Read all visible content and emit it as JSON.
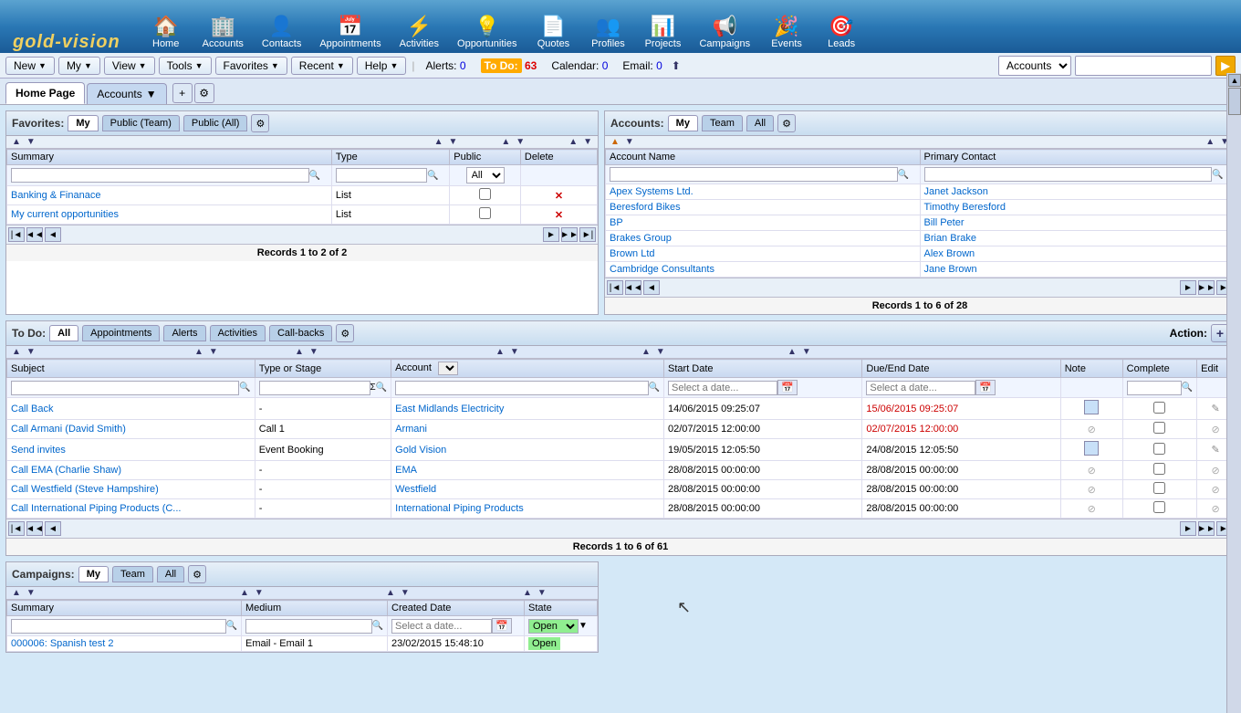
{
  "logo": {
    "text": "gold-vision"
  },
  "topnav": {
    "items": [
      {
        "id": "home",
        "label": "Home",
        "icon": "🏠"
      },
      {
        "id": "accounts",
        "label": "Accounts",
        "icon": "🏢"
      },
      {
        "id": "contacts",
        "label": "Contacts",
        "icon": "👤"
      },
      {
        "id": "appointments",
        "label": "Appointments",
        "icon": "📅"
      },
      {
        "id": "activities",
        "label": "Activities",
        "icon": "⚡"
      },
      {
        "id": "opportunities",
        "label": "Opportunities",
        "icon": "💡"
      },
      {
        "id": "quotes",
        "label": "Quotes",
        "icon": "📄"
      },
      {
        "id": "profiles",
        "label": "Profiles",
        "icon": "👥"
      },
      {
        "id": "projects",
        "label": "Projects",
        "icon": "📊"
      },
      {
        "id": "campaigns",
        "label": "Campaigns",
        "icon": "📢"
      },
      {
        "id": "events",
        "label": "Events",
        "icon": "🎉"
      },
      {
        "id": "leads",
        "label": "Leads",
        "icon": "🎯"
      }
    ]
  },
  "toolbar": {
    "new_label": "New",
    "my_label": "My",
    "view_label": "View",
    "tools_label": "Tools",
    "favorites_label": "Favorites",
    "recent_label": "Recent",
    "help_label": "Help",
    "alerts_label": "Alerts:",
    "alerts_count": "0",
    "todo_label": "To Do:",
    "todo_count": "63",
    "calendar_label": "Calendar:",
    "calendar_count": "0",
    "email_label": "Email:",
    "email_count": "0",
    "search_placeholder": "",
    "search_select_value": "Accounts"
  },
  "tabs": {
    "home_label": "Home Page",
    "accounts_label": "Accounts"
  },
  "favorites_panel": {
    "title": "Favorites:",
    "tabs": [
      "My",
      "Public (Team)",
      "Public (All)"
    ],
    "active_tab": "My",
    "columns": {
      "summary": "Summary",
      "type": "Type",
      "public": "Public",
      "delete": "Delete"
    },
    "rows": [
      {
        "summary": "Banking & Finanace",
        "type": "List",
        "public": false
      },
      {
        "summary": "My current opportunities",
        "type": "List",
        "public": false
      }
    ],
    "records_info": "Records 1 to 2 of 2"
  },
  "accounts_panel": {
    "title": "Accounts:",
    "tabs": [
      "My",
      "Team",
      "All"
    ],
    "active_tab": "My",
    "columns": {
      "account_name": "Account Name",
      "primary_contact": "Primary Contact"
    },
    "rows": [
      {
        "account": "Apex Systems Ltd.",
        "contact": "Janet Jackson"
      },
      {
        "account": "Beresford Bikes",
        "contact": "Timothy Beresford"
      },
      {
        "account": "BP",
        "contact": "Bill Peter"
      },
      {
        "account": "Brakes Group",
        "contact": "Brian Brake"
      },
      {
        "account": "Brown Ltd",
        "contact": "Alex Brown"
      },
      {
        "account": "Cambridge Consultants",
        "contact": "Jane Brown"
      }
    ],
    "records_info": "Records 1 to 6 of 28"
  },
  "todo_panel": {
    "title": "To Do:",
    "tabs": [
      "All",
      "Appointments",
      "Alerts",
      "Activities",
      "Call-backs"
    ],
    "active_tab": "All",
    "action_label": "Action:",
    "columns": {
      "subject": "Subject",
      "type_stage": "Type or Stage",
      "account": "Account",
      "start_date": "Start Date",
      "due_end_date": "Due/End Date",
      "note": "Note",
      "complete": "Complete",
      "edit": "Edit"
    },
    "filter": {
      "account_placeholder": "",
      "start_date_placeholder": "Select a date...",
      "due_date_placeholder": "Select a date..."
    },
    "rows": [
      {
        "subject": "Call Back",
        "type_stage": "-",
        "account": "East Midlands Electricity",
        "start_date": "14/06/2015 09:25:07",
        "due_date": "15/06/2015 09:25:07",
        "due_overdue": true,
        "has_note": true,
        "complete": false
      },
      {
        "subject": "Call Armani (David Smith)",
        "type_stage": "Call 1",
        "account": "Armani",
        "start_date": "02/07/2015 12:00:00",
        "due_date": "02/07/2015 12:00:00",
        "due_overdue": true,
        "has_note": false,
        "complete": false
      },
      {
        "subject": "Send invites",
        "type_stage": "Event Booking",
        "account": "Gold Vision",
        "start_date": "19/05/2015 12:05:50",
        "due_date": "24/08/2015 12:05:50",
        "due_overdue": false,
        "has_note": true,
        "complete": false
      },
      {
        "subject": "Call EMA (Charlie Shaw)",
        "type_stage": "-",
        "account": "EMA",
        "start_date": "28/08/2015 00:00:00",
        "due_date": "28/08/2015 00:00:00",
        "due_overdue": false,
        "has_note": false,
        "complete": false
      },
      {
        "subject": "Call Westfield (Steve Hampshire)",
        "type_stage": "-",
        "account": "Westfield",
        "start_date": "28/08/2015 00:00:00",
        "due_date": "28/08/2015 00:00:00",
        "due_overdue": false,
        "has_note": false,
        "complete": false
      },
      {
        "subject": "Call International Piping Products (C...",
        "type_stage": "-",
        "account": "International Piping Products",
        "start_date": "28/08/2015 00:00:00",
        "due_date": "28/08/2015 00:00:00",
        "due_overdue": false,
        "has_note": false,
        "complete": false
      }
    ],
    "records_info": "Records 1 to 6 of 61"
  },
  "campaigns_panel": {
    "title": "Campaigns:",
    "tabs": [
      "My",
      "Team",
      "All"
    ],
    "active_tab": "My",
    "columns": {
      "summary": "Summary",
      "medium": "Medium",
      "created_date": "Created Date",
      "state": "State"
    },
    "filter": {
      "medium_placeholder": "",
      "date_placeholder": "Select a date...",
      "state_value": "Open"
    },
    "rows": [
      {
        "summary": "000006: Spanish test 2",
        "medium": "Email - Email 1",
        "created_date": "23/02/2015 15:48:10",
        "state": "Open"
      }
    ]
  },
  "icons": {
    "dropdown": "▼",
    "up_arrow": "▲",
    "down_arrow": "▼",
    "left_arrow": "◄",
    "right_arrow": "►",
    "first_arrow": "|◄",
    "last_arrow": "►|",
    "prev_page": "◄◄",
    "next_page": "►►",
    "search": "🔍",
    "gear": "⚙",
    "plus": "+",
    "calendar": "📅",
    "delete": "✕",
    "edit": "✎",
    "slash": "⊘"
  }
}
